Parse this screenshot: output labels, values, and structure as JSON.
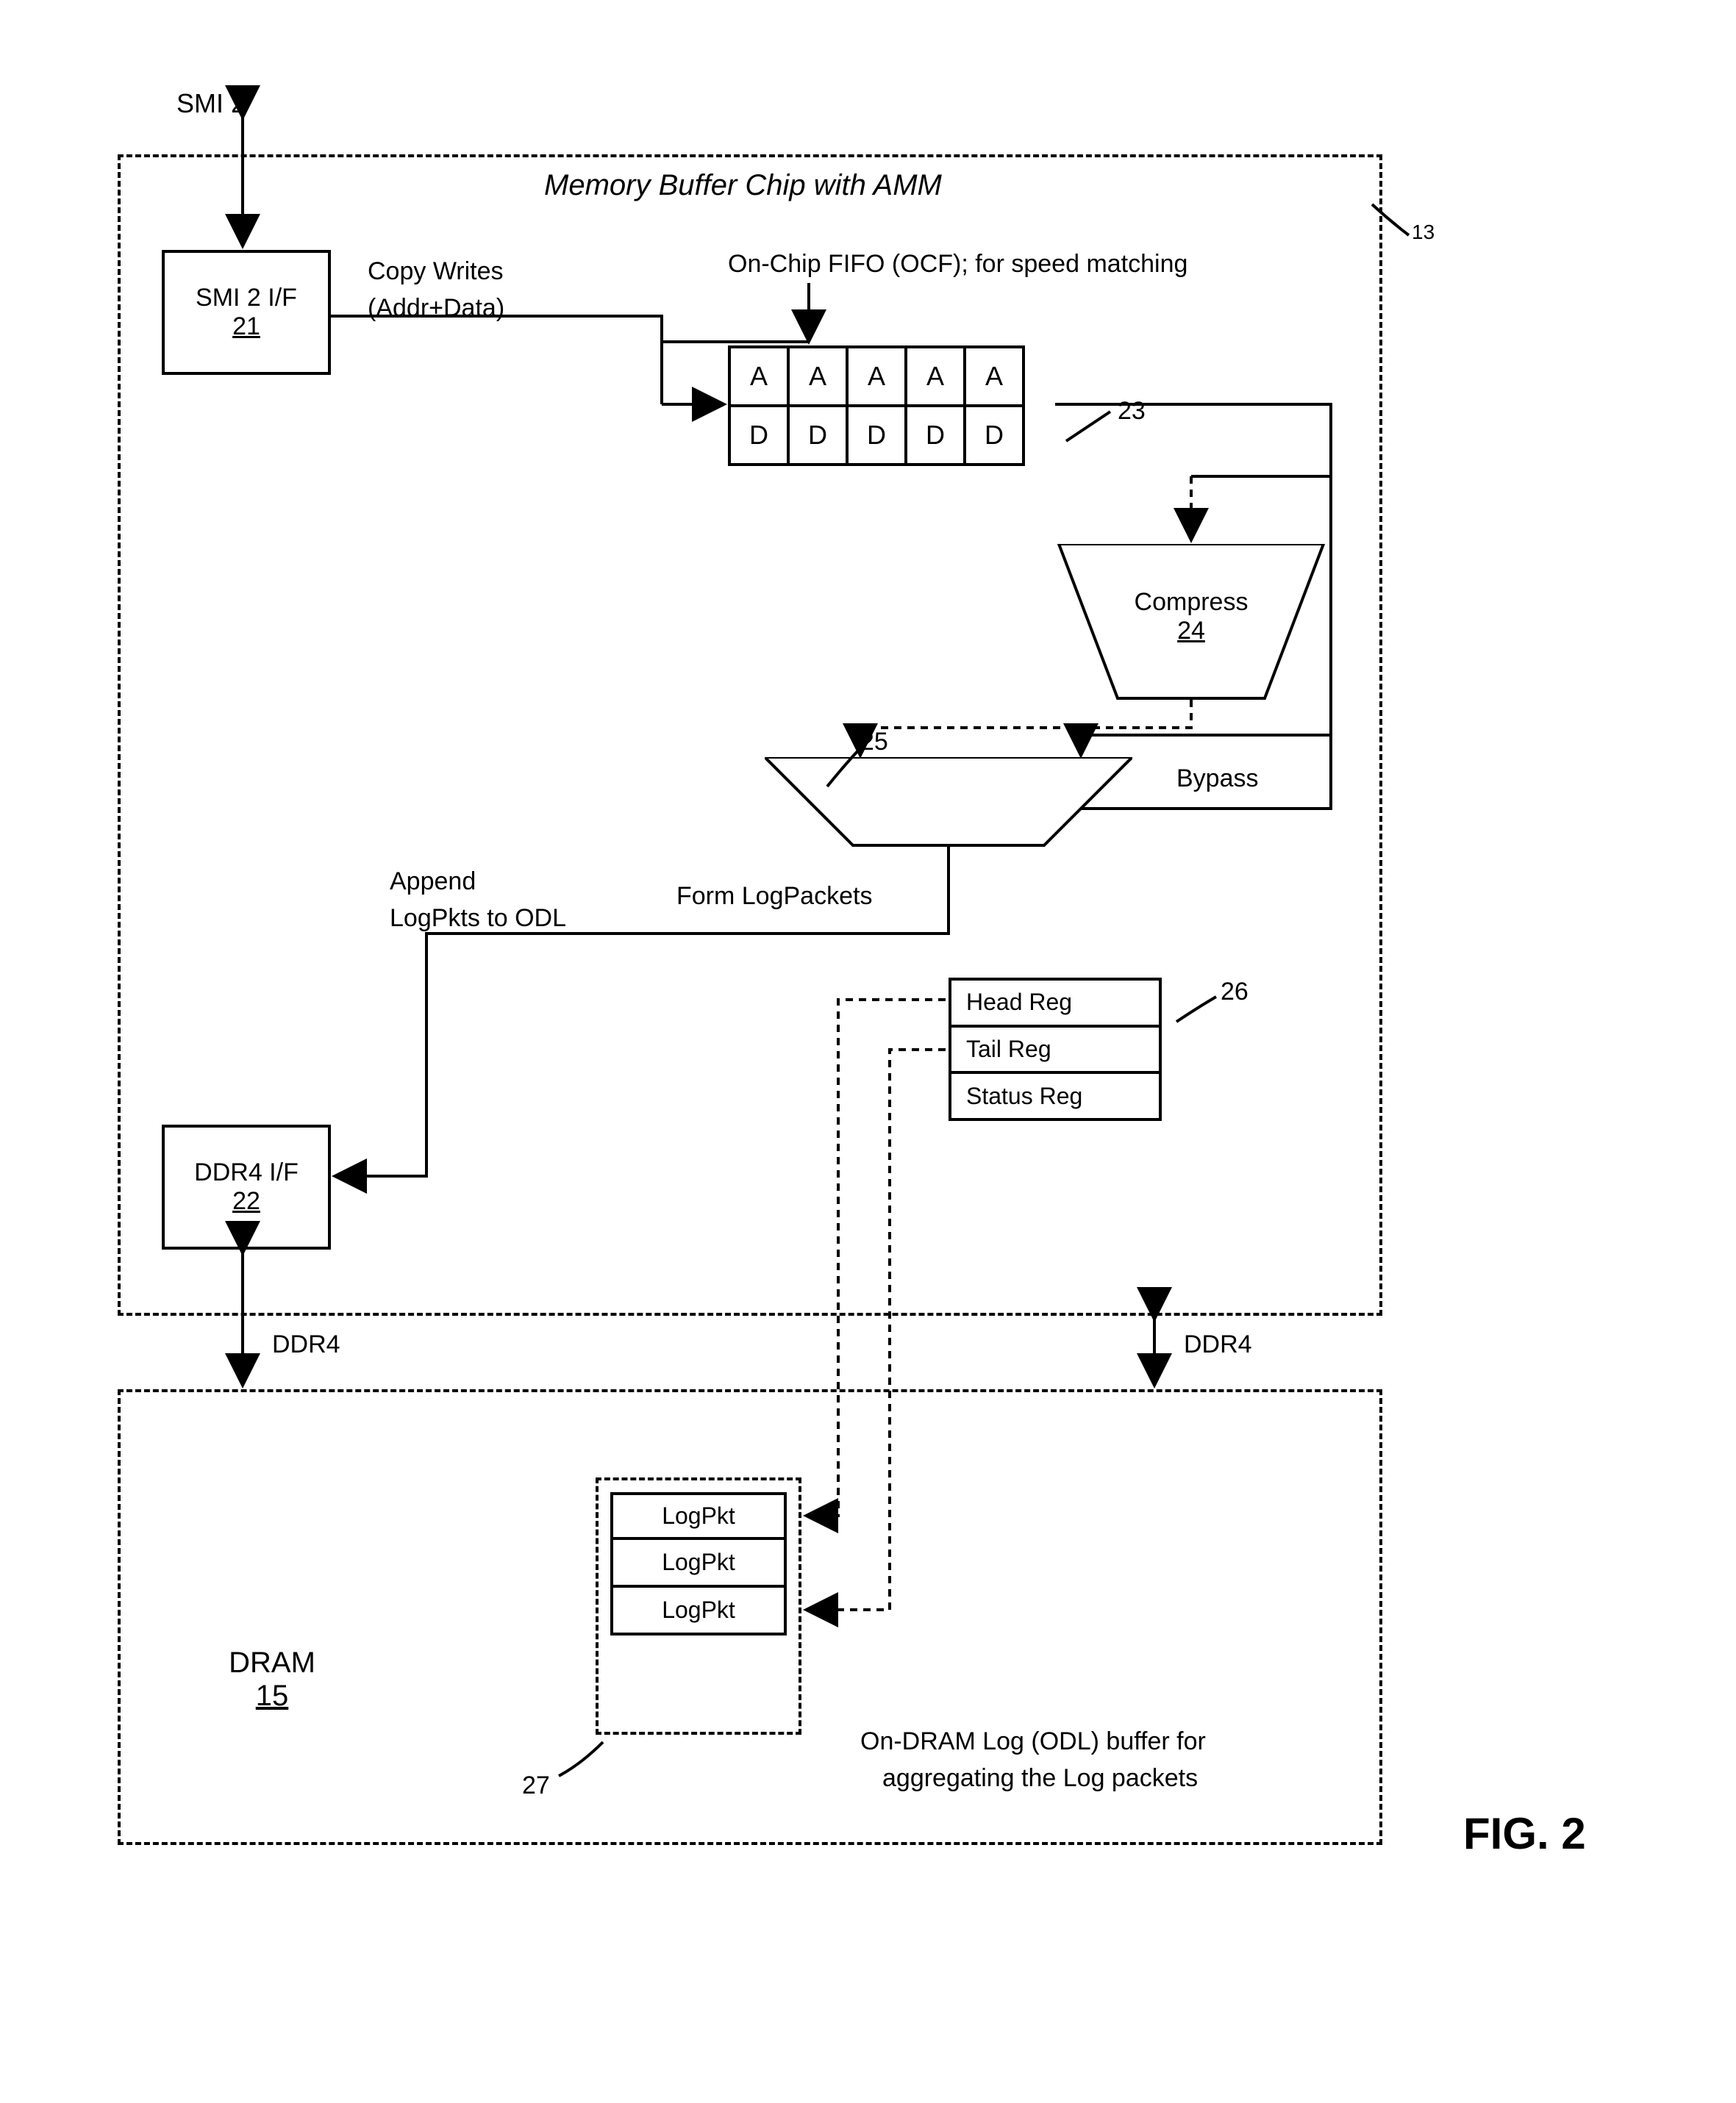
{
  "title": "Memory Buffer Chip with AMM",
  "figure_label": "FIG. 2",
  "chip_ref": "13",
  "smi_external": "SMI 2",
  "smi_if": {
    "name": "SMI 2 I/F",
    "ref": "21"
  },
  "ddr4_if": {
    "name": "DDR4 I/F",
    "ref": "22"
  },
  "copy_writes_l1": "Copy Writes",
  "copy_writes_l2": "(Addr+Data)",
  "ocf_label": "On-Chip FIFO (OCF); for speed matching",
  "ocf_ref": "23",
  "fifo_row_a": [
    "A",
    "A",
    "A",
    "A",
    "A"
  ],
  "fifo_row_d": [
    "D",
    "D",
    "D",
    "D",
    "D"
  ],
  "compress": {
    "name": "Compress",
    "ref": "24"
  },
  "bypass": "Bypass",
  "form_logpackets": "Form LogPackets",
  "mux_ref": "25",
  "append_l1": "Append",
  "append_l2": "LogPkts to ODL",
  "regs": {
    "head": "Head Reg",
    "tail": "Tail Reg",
    "status": "Status Reg",
    "ref": "26"
  },
  "ddr4_label_left": "DDR4",
  "ddr4_label_right": "DDR4",
  "dram": {
    "name": "DRAM",
    "ref": "15"
  },
  "odl": {
    "items": [
      "LogPkt",
      "LogPkt",
      "LogPkt"
    ],
    "ref": "27",
    "desc_l1": "On-DRAM Log (ODL) buffer for",
    "desc_l2": "aggregating the Log packets"
  }
}
